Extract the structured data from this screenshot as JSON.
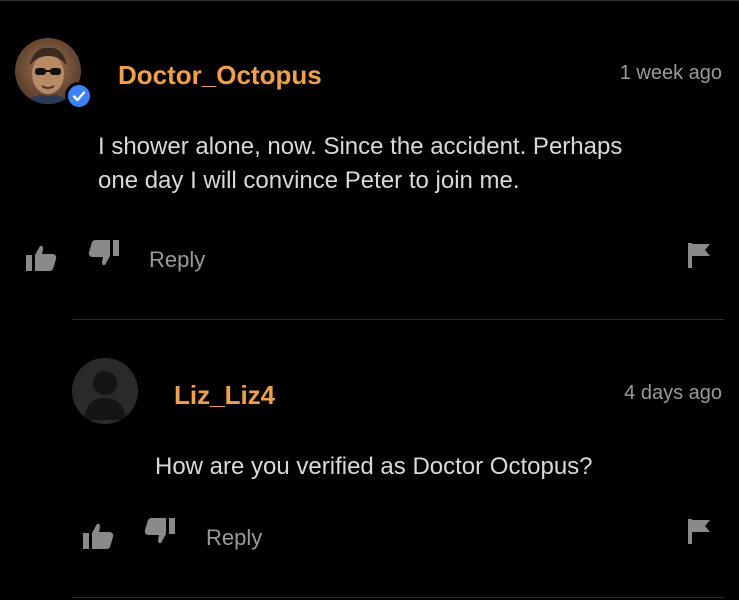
{
  "comments": [
    {
      "username": "Doctor_Octopus",
      "time": "1 week ago",
      "text_line1": "I shower alone, now. Since the accident. Perhaps",
      "text_line2": "one day I will convince Peter to join me.",
      "reply_label": "Reply",
      "verified": true
    },
    {
      "username": "Liz_Liz4",
      "time": "4 days ago",
      "text": "How are you verified as Doctor Octopus?",
      "reply_label": "Reply",
      "verified": false
    }
  ],
  "colors": {
    "username": "#f0a04b",
    "verified_badge": "#3b82f6",
    "background": "#000000"
  }
}
